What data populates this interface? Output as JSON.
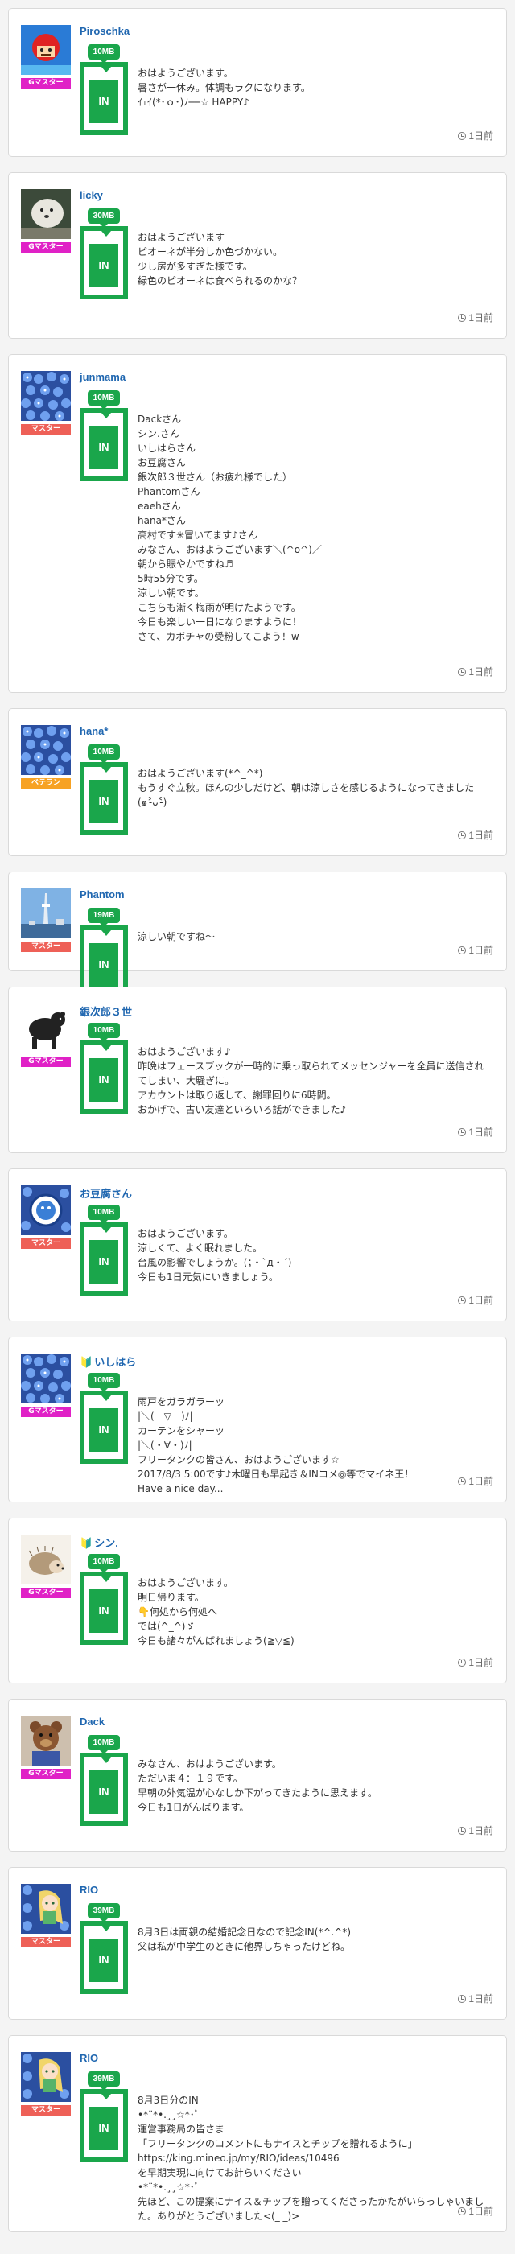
{
  "posts": [
    {
      "username": "Piroschka",
      "leaf": "",
      "badge": "Gマスター",
      "badge_type": "g",
      "mb": "10MB",
      "in_label": "IN",
      "body": "おはようございます。\n暑さが一休み。体調もラクになります。\nｲｪｲ(*･ｏ･)ﾉ──☆ HAPPY♪",
      "time": "1日前",
      "avatar": "mario-red-icon"
    },
    {
      "username": "licky",
      "leaf": "",
      "badge": "Gマスター",
      "badge_type": "g",
      "mb": "30MB",
      "in_label": "IN",
      "body": "おはようございます\nピオーネが半分しか色づかない。\n少し房が多すぎた様です。\n緑色のピオーネは食べられるのかな？",
      "time": "1日前",
      "avatar": "white-dog-icon"
    },
    {
      "username": "junmama",
      "leaf": "",
      "badge": "マスター",
      "badge_type": "m",
      "mb": "10MB",
      "in_label": "IN",
      "body": "Dackさん\nシン.さん\nいしはらさん\nお豆腐さん\n銀次郎３世さん（お疲れ様でした）\nPhantomさん\neaehさん\nhana*さん\n高村です✳︎冒いてます♪さん\nみなさん、おはようございます＼(^o^)／\n朝から賑やかですね♬\n5時55分です。\n涼しい朝です。\nこちらも漸く梅雨が明けたようです。\n今日も楽しい一日になりますように！\nさて、カボチャの受粉してこよう！w",
      "time": "1日前",
      "avatar": "blue-flowers-icon"
    },
    {
      "username": "hana*",
      "leaf": "",
      "badge": "ベテラン",
      "badge_type": "v",
      "mb": "10MB",
      "in_label": "IN",
      "body": "おはようございます(*^_^*)\nもうすぐ立秋。ほんの少しだけど、朝は涼しさを感じるようになってきました(๑˃̵ᴗ˂̵)",
      "time": "1日前",
      "avatar": "blue-flowers-icon"
    },
    {
      "username": "Phantom",
      "leaf": "",
      "badge": "マスター",
      "badge_type": "m",
      "mb": "19MB",
      "in_label": "IN",
      "body": "涼しい朝ですね〜",
      "time": "1日前",
      "avatar": "tower-icon"
    },
    {
      "username": "銀次郎３世",
      "leaf": "",
      "badge": "Gマスター",
      "badge_type": "g",
      "mb": "10MB",
      "in_label": "IN",
      "body": "おはようございます♪\n昨晩はフェースブックが一時的に乗っ取られてメッセンジャーを全員に送信されてしまい、大騒ぎに。\nアカウントは取り返して、謝罪回りに6時間。\nおかげで、古い友達といろいろ話ができました♪",
      "time": "1日前",
      "avatar": "black-bear-icon"
    },
    {
      "username": "お豆腐さん",
      "leaf": "",
      "badge": "マスター",
      "badge_type": "m",
      "mb": "10MB",
      "in_label": "IN",
      "body": "おはようございます。\n涼しくて、よく眠れました。\n台風の影響でしょうか。(；・`д・´)\n今日も1日元気にいきましょう。",
      "time": "1日前",
      "avatar": "mineo-badge-icon"
    },
    {
      "username": "いしはら",
      "leaf": "🔰",
      "badge": "Gマスター",
      "badge_type": "g",
      "mb": "10MB",
      "in_label": "IN",
      "body": "雨戸をガラガラーッ\n|＼(￣▽￣)ﾉ|\nカーテンをシャーッ\n|＼(・∀・)ﾉ|\nフリータンクの皆さん、おはようございます☆\n2017/8/3 5:00です♪木曜日も早起き＆INコメ◎等でマイネ王！\nHave a nice day...",
      "time": "1日前",
      "avatar": "blue-flowers-icon"
    },
    {
      "username": "シン.",
      "leaf": "🔰",
      "badge": "Gマスター",
      "badge_type": "g",
      "mb": "10MB",
      "in_label": "IN",
      "body": "おはようございます。\n明日帰ります。\n👇何処から何処へ\nでは(^_^)ゞ\n今日も諸々がんばれましょう(≧▽≦)",
      "time": "1日前",
      "avatar": "hedgehog-icon"
    },
    {
      "username": "Dack",
      "leaf": "",
      "badge": "Gマスター",
      "badge_type": "g",
      "mb": "10MB",
      "in_label": "IN",
      "body": "みなさん、おはようございます。\nただいま４：１９です。\n早朝の外気温が心なしか下がってきたように思えます。\n今日も1日がんばります。",
      "time": "1日前",
      "avatar": "teddy-bear-icon"
    },
    {
      "username": "RIO",
      "leaf": "",
      "badge": "マスター",
      "badge_type": "m",
      "mb": "39MB",
      "in_label": "IN",
      "body": "8月3日は両親の結婚記念日なので記念IN(*^.^*)\n父は私が中学生のときに他界しちゃったけどね。",
      "time": "1日前",
      "avatar": "anime-girl-icon"
    },
    {
      "username": "RIO",
      "leaf": "",
      "badge": "マスター",
      "badge_type": "m",
      "mb": "39MB",
      "in_label": "IN",
      "body": "8月3日分のIN\n•*¨*•.¸¸☆*･ﾟ\n運営事務局の皆さま\n「フリータンクのコメントにもナイスとチップを贈れるように」\nhttps://king.mineo.jp/my/RIO/ideas/10496\nを早期実現に向けてお計らいください\n•*¨*•.¸¸☆*･ﾟ\n先ほど、この提案にナイス＆チップを贈ってくださったかたがいらっしゃいました。ありがとうございました<(_ _)>",
      "time": "1日前",
      "avatar": "anime-girl-icon"
    }
  ]
}
